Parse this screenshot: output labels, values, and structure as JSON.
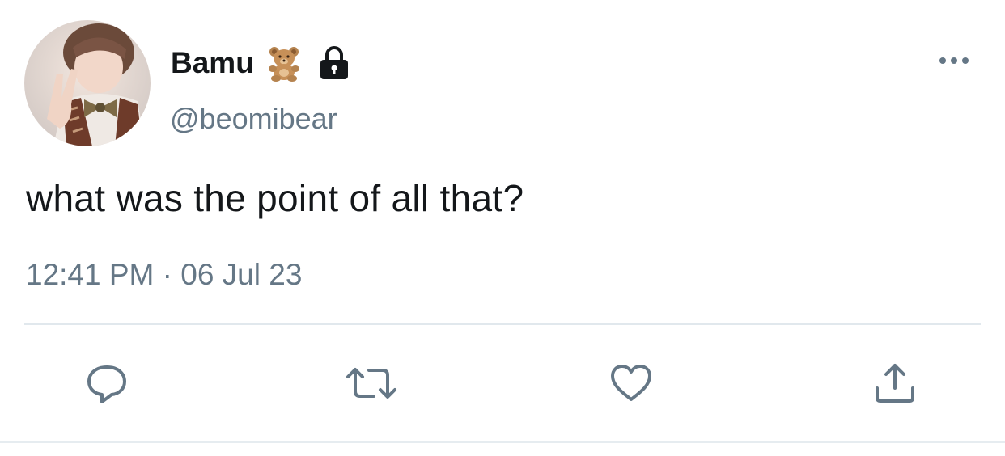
{
  "author": {
    "display_name": "Bamu",
    "handle": "@beomibear",
    "name_emoji": "teddy-bear-icon",
    "protected_badge": "lock-icon",
    "avatar": "avatar"
  },
  "tweet": {
    "text": "what was the point of all that?",
    "timestamp": "12:41 PM · 06 Jul 23"
  },
  "actions": [
    "reply-icon",
    "retweet-icon",
    "like-icon",
    "share-icon"
  ],
  "menu": {
    "icon": "more-icon"
  },
  "colors": {
    "text_primary": "#14171a",
    "text_secondary": "#657786",
    "icon_gray": "#657786",
    "divider": "#e1e8ed"
  }
}
